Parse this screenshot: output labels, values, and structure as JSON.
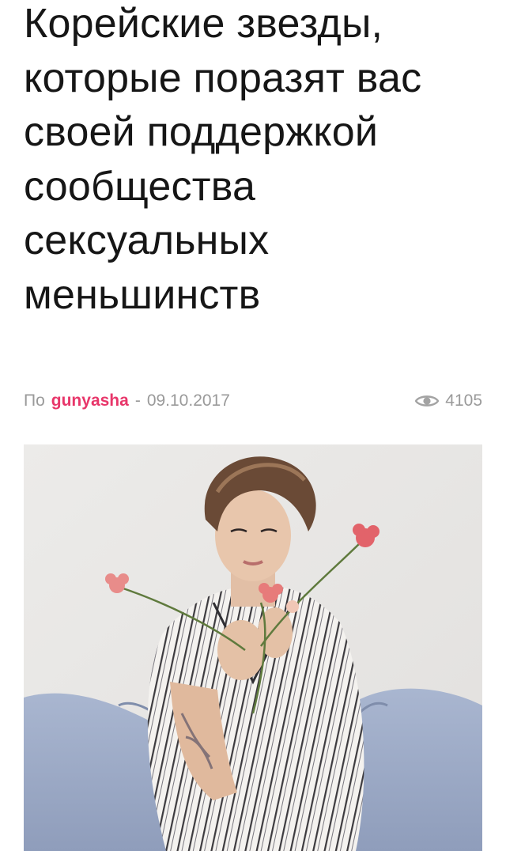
{
  "article": {
    "title": "Корейские звезды, которые поразят вас своей поддержкой сообщества сексуальных меньшинств",
    "by_prefix": "По",
    "author": "gunyasha",
    "separator": "-",
    "date": "09.10.2017",
    "views": "4105",
    "views_icon": "eye-icon"
  },
  "colors": {
    "author_accent": "#e8366a",
    "meta_text": "#9a9a9a",
    "title_text": "#161616"
  }
}
